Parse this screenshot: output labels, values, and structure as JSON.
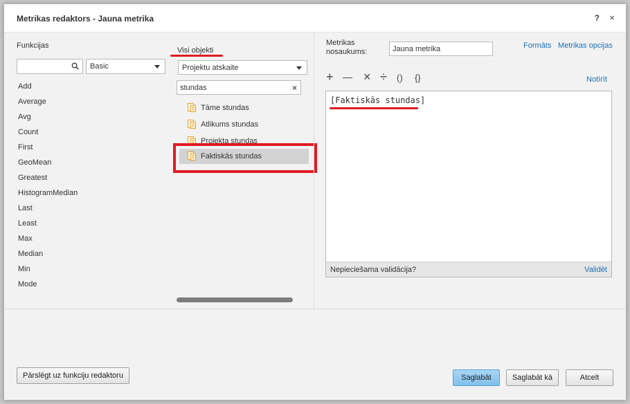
{
  "dialog": {
    "title": "Metrikas redaktors - Jauna metrika",
    "help": "?",
    "close": "×"
  },
  "functions": {
    "label": "Funkcijas",
    "search_value": "",
    "category": "Basic",
    "items": [
      "Add",
      "Average",
      "Avg",
      "Count",
      "First",
      "GeoMean",
      "Greatest",
      "HistogramMedian",
      "Last",
      "Least",
      "Max",
      "Median",
      "Min",
      "Mode"
    ]
  },
  "objects": {
    "label": "Visi objekti",
    "source": "Projektu atskaite",
    "search_value": "stundas",
    "clear": "×",
    "items": [
      {
        "label": "Tāme stundas",
        "selected": false
      },
      {
        "label": "Atlikums stundas",
        "selected": false
      },
      {
        "label": "Projekta stundas",
        "selected": false
      },
      {
        "label": "Faktiskās stundas",
        "selected": true
      }
    ]
  },
  "metric": {
    "name_label_1": "Metrikas",
    "name_label_2": "nosaukums:",
    "name_value": "Jauna metrika",
    "formats_link": "Formāts",
    "options_link": "Metrikas opcijas",
    "clear_link": "Notīrīt",
    "operators": [
      "+",
      "—",
      "×",
      "÷",
      "()",
      "{}"
    ],
    "expression": "[Faktiskās stundas]",
    "validation_msg": "Nepieciešama validācija?",
    "validate_link": "Validēt"
  },
  "footer": {
    "switch_button": "Pārslēgt uz funkciju redaktoru",
    "save": "Saglabāt",
    "save_as": "Saglabāt kā",
    "cancel": "Atcelt"
  },
  "colors": {
    "accent_link": "#1a6fb5",
    "annotation_red": "#e01b24",
    "primary_button": "#8cc8ef",
    "icon_orange": "#e8a020"
  }
}
